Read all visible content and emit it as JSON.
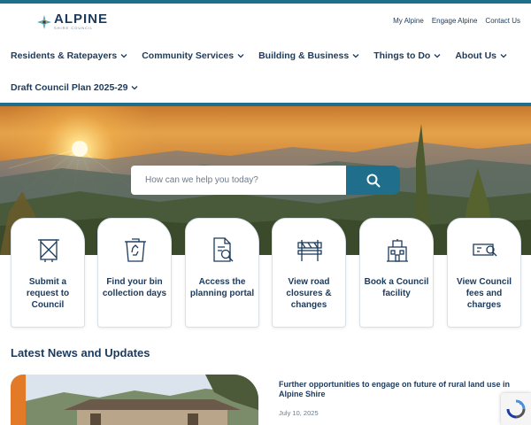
{
  "brand": {
    "name": "ALPINE",
    "subtitle": "SHIRE COUNCIL",
    "colors": {
      "navy": "#1b3a5c",
      "teal": "#1f6e8c",
      "orange": "#e37a27"
    }
  },
  "utility_links": [
    "My Alpine",
    "Engage Alpine",
    "Contact Us"
  ],
  "nav": {
    "row1": [
      "Residents & Ratepayers",
      "Community Services",
      "Building & Business",
      "Things to Do",
      "About Us"
    ],
    "row2": [
      "Draft Council Plan 2025-29"
    ]
  },
  "search": {
    "placeholder": "How can we help you today?",
    "icon": "search-icon"
  },
  "quick_links": [
    {
      "label": "Submit a request to Council",
      "icon": "request-form-icon"
    },
    {
      "label": "Find your bin collection days",
      "icon": "recycling-bin-icon"
    },
    {
      "label": "Access the planning portal",
      "icon": "document-search-icon"
    },
    {
      "label": "View road closures & changes",
      "icon": "road-barrier-icon"
    },
    {
      "label": "Book a Council facility",
      "icon": "building-icon"
    },
    {
      "label": "View Council fees and charges",
      "icon": "fee-search-icon"
    }
  ],
  "news": {
    "heading": "Latest News and Updates",
    "items": [
      {
        "title": "Further opportunities to engage on future of rural land use in Alpine Shire",
        "date": "July 10, 2025"
      }
    ]
  }
}
